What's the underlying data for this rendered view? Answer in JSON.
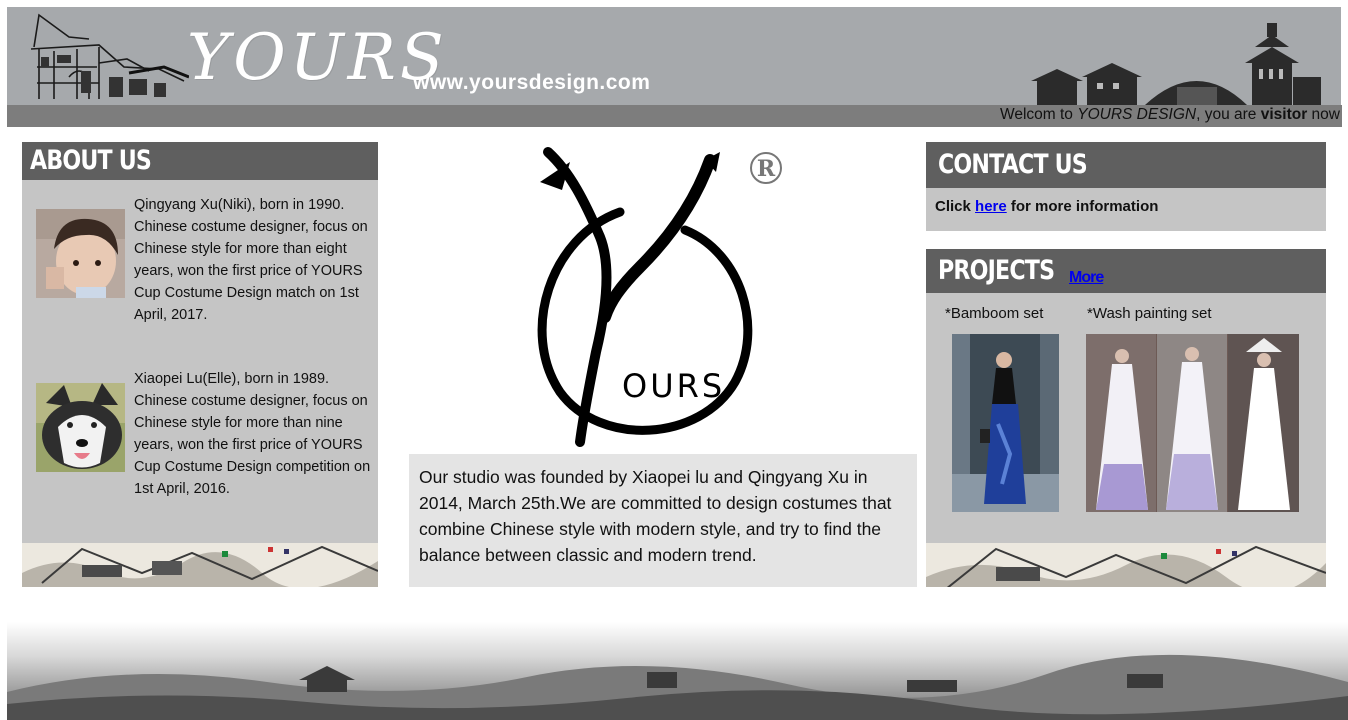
{
  "header": {
    "logo_text": "YOURS",
    "site_url": "www.yoursdesign.com",
    "welcome": {
      "prefix": "Welcom to ",
      "brand": "YOURS DESIGN",
      "middle": ", you are ",
      "role": "visitor",
      "suffix": " now"
    }
  },
  "about": {
    "title": "ABOUT US",
    "people": [
      {
        "bio": "Qingyang Xu(Niki), born in 1990. Chinese costume designer, focus on Chinese style for more than eight years, won the first price of YOURS Cup Costume Design match on 1st April, 2017."
      },
      {
        "bio": "Xiaopei Lu(Elle), born in 1989. Chinese costume designer, focus on Chinese style for more than nine years, won the first price of YOURS Cup Costume Design competition on 1st April, 2016."
      }
    ]
  },
  "center": {
    "logo_text": "OURS",
    "registered_mark": "®",
    "intro": "Our studio was founded by Xiaopei lu and Qingyang Xu in 2014, March 25th.We are committed to design costumes that combine Chinese style with modern style, and try to find the balance between classic and modern trend."
  },
  "contact": {
    "title": "CONTACT US",
    "prefix": "Click ",
    "link": "here",
    "suffix": " for more information"
  },
  "projects": {
    "title": "PROJECTS",
    "more_link": "More",
    "sets": [
      {
        "label": "*Bamboom set"
      },
      {
        "label": "*Wash painting set"
      }
    ]
  },
  "colors": {
    "header_bg": "#a6a9ac",
    "welcome_bar": "#7d7d7d",
    "panel_bg": "#c5c5c5",
    "panel_title_bg": "#5f5f5f",
    "intro_bg": "#e4e4e4",
    "link": "#0000ee"
  }
}
